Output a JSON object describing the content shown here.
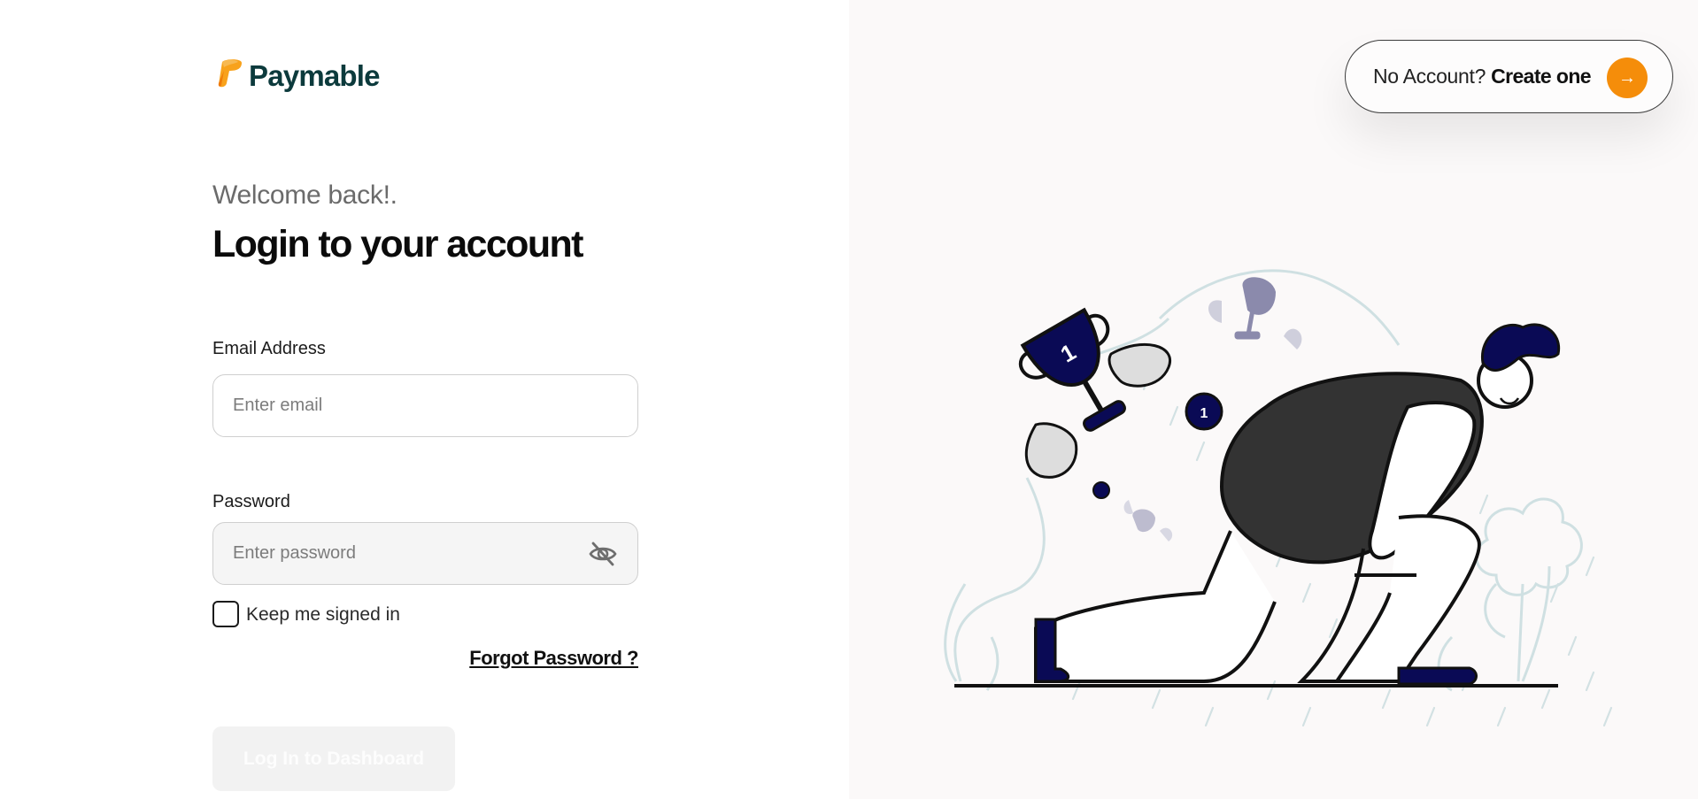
{
  "brand": {
    "name": "Paymable",
    "accent": "#f58d0a",
    "text_color": "#0c3a3c"
  },
  "header": {
    "welcome": "Welcome back!.",
    "title": "Login to your account"
  },
  "form": {
    "email": {
      "label": "Email Address",
      "placeholder": "Enter email",
      "value": ""
    },
    "password": {
      "label": "Password",
      "placeholder": "Enter password",
      "value": "",
      "toggle_icon": "eye-off-icon"
    },
    "keep_signed_in": {
      "label": "Keep me signed in",
      "checked": false
    },
    "forgot_link": "Forgot Password ?",
    "submit_label": "Log In to Dashboard",
    "submit_enabled": false
  },
  "signup_cta": {
    "question": "No Account?",
    "action": "Create one",
    "icon": "arrow-right-icon",
    "icon_bg": "#f58d0a"
  },
  "illustration": {
    "icon": "kneeling-person-losing-trophy-illustration"
  }
}
